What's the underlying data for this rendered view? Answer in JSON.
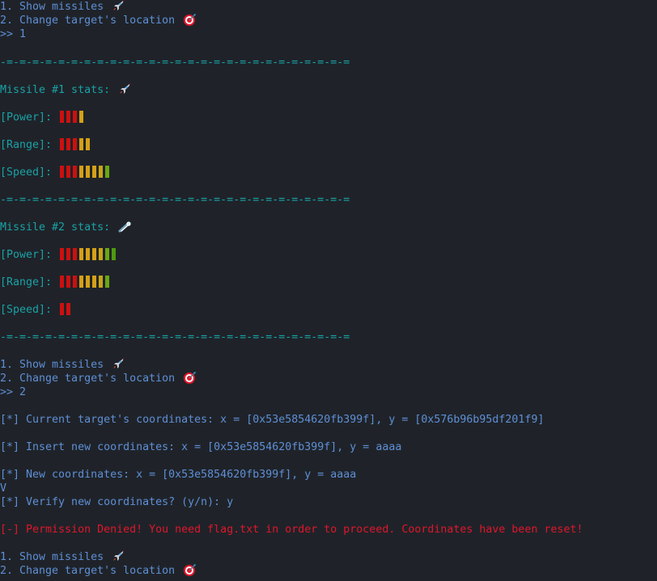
{
  "menu1": {
    "item1": "1. Show missiles",
    "item2": "2. Change target's location",
    "prompt": ">> 1"
  },
  "separator": "-=-=-=-=-=-=-=-=-=-=-=-=-=-=-=-=-=-=-=-=-=-=-=-=-=-=-=",
  "missile1": {
    "title": "Missile #1 stats:",
    "power_label": "[Power]:",
    "range_label": "[Range]:",
    "speed_label": "[Speed]:",
    "power": 4,
    "range": 5,
    "speed": 8
  },
  "missile2": {
    "title": "Missile #2 stats:",
    "power_label": "[Power]:",
    "range_label": "[Range]:",
    "speed_label": "[Speed]:",
    "power": 9,
    "range": 8,
    "speed": 2
  },
  "bar_colors": [
    "#cc1010",
    "#cc1010",
    "#cc1010",
    "#d4a017",
    "#d4a017",
    "#d4a017",
    "#c8a417",
    "#6aa612",
    "#4f9a10"
  ],
  "menu2": {
    "item1": "1. Show missiles",
    "item2": "2. Change target's location",
    "prompt": ">> 2"
  },
  "session": {
    "current": "[*] Current target's coordinates: x = [0x53e5854620fb399f], y = [0x576b96b95df201f9]",
    "insert": "[*] Insert new coordinates: x = [0x53e5854620fb399f], y = aaaa",
    "new": "[*] New coordinates: x = [0x53e5854620fb399f], y = aaaa",
    "v": "V",
    "verify": "[*] Verify new coordinates? (y/n): y",
    "denied": "[-] Permission Denied! You need flag.txt in order to proceed. Coordinates have been reset!"
  },
  "menu3": {
    "item1": "1. Show missiles",
    "item2": "2. Change target's location"
  },
  "icons": {
    "rocket": "rocket-icon",
    "target": "target-icon",
    "comet": "comet-icon"
  }
}
